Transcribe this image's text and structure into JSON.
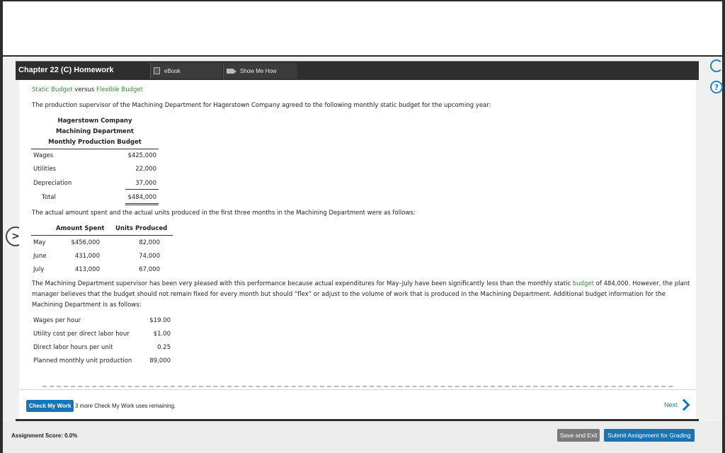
{
  "header": {
    "title": "Chapter 22 (C) Homework",
    "tabs": [
      {
        "label": "eBook",
        "icon": "book-icon"
      },
      {
        "label": "Show Me How",
        "icon": "video-icon"
      }
    ]
  },
  "content": {
    "topic": {
      "part1": "Static Budget",
      "part2": "versus",
      "part3": "Flexible Budget"
    },
    "intro": "The production supervisor of the Machining Department for Hagerstown Company agreed to the following monthly static budget for the upcoming year:",
    "budget_table": {
      "headings": [
        "Hagerstown Company",
        "Machining Department",
        "Monthly Production Budget"
      ],
      "rows": [
        {
          "label": "Wages",
          "value": "$425,000"
        },
        {
          "label": "Utilities",
          "value": "22,000"
        },
        {
          "label": "Depreciation",
          "value": "37,000"
        },
        {
          "label": "Total",
          "value": "$484,000"
        }
      ]
    },
    "actual_intro": "The actual amount spent and the actual units produced in the first three months in the Machining Department were as follows:",
    "actual_table": {
      "col_amount": "Amount Spent",
      "col_units": "Units Produced",
      "rows": [
        {
          "month": "May",
          "amount": "$456,000",
          "units": "82,000"
        },
        {
          "month": "June",
          "amount": "431,000",
          "units": "74,000"
        },
        {
          "month": "July",
          "amount": "413,000",
          "units": "67,000"
        }
      ]
    },
    "paragraph": {
      "line1_a": "The Machining Department supervisor has been very pleased with this performance because actual expenditures for May–July have been significantly less than the monthly static",
      "line1_link": "budget",
      "line1_b": "of 484,000. However, the plant",
      "line2": "manager believes that the budget should not remain fixed for every month but should “flex” or adjust to the volume of work that is produced in the Machining Department. Additional budget information for the",
      "line3": "Machining Department is as follows:"
    },
    "info_table": {
      "rows": [
        {
          "label": "Wages per hour",
          "value": "$19.00"
        },
        {
          "label": "Utility cost per direct labor hour",
          "value": "$1.00"
        },
        {
          "label": "Direct labor hours per unit",
          "value": "0.25"
        },
        {
          "label": "Planned monthly unit production",
          "value": "89,000"
        }
      ]
    }
  },
  "actions": {
    "check_my_work": "Check My Work",
    "check_note": "3 more Check My Work uses remaining.",
    "next": "Next"
  },
  "footer": {
    "score": "Assignment Score: 0.0%",
    "save_exit": "Save and Exit",
    "submit": "Submit Assignment for Grading"
  },
  "colors": {
    "accent": "#1a73b4",
    "link_green": "#3a8a3a",
    "header_dark": "#2e2e2e"
  }
}
